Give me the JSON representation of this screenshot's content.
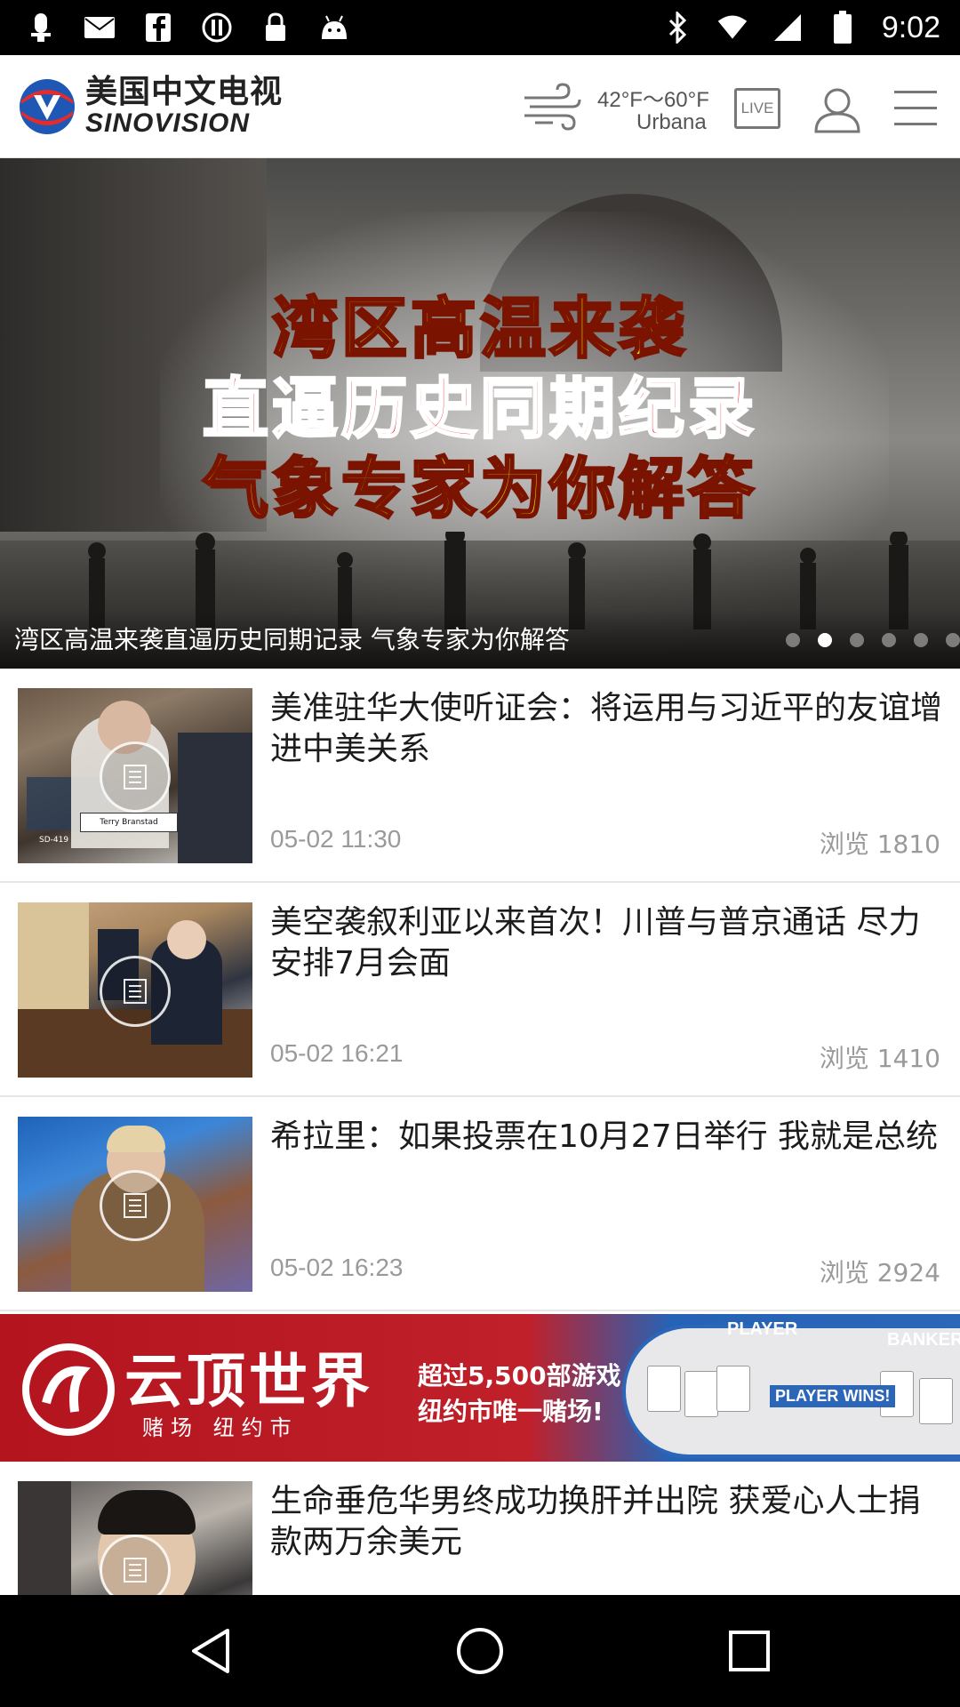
{
  "status_bar": {
    "time": "9:02",
    "left_icons": [
      "notification-icon",
      "mail-icon",
      "facebook-icon",
      "circle-alert-icon",
      "lock-icon",
      "android-icon"
    ],
    "right_icons": [
      "bluetooth-icon",
      "wifi-icon",
      "signal-icon",
      "battery-icon"
    ]
  },
  "header": {
    "logo_cn": "美国中文电视",
    "logo_en": "SINOVISION",
    "weather": {
      "temp": "42°F～60°F",
      "city": "Urbana",
      "icon": "wind-icon"
    },
    "live_label": "LIVE",
    "user_icon": "user-icon",
    "menu_icon": "hamburger-menu-icon"
  },
  "banner": {
    "overlay_lines": [
      "湾区高温来袭",
      "直逼历史同期纪录",
      "气象专家为你解答"
    ],
    "caption": "湾区高温来袭直逼历史同期记录 气象专家为你解答",
    "dot_count": 6,
    "active_dot": 1
  },
  "feed": {
    "items": [
      {
        "title": "美准驻华大使听证会：将运用与习近平的友谊增进中美关系",
        "time": "05-02 11:30",
        "views": "浏览 1810"
      },
      {
        "title": "美空袭叙利亚以来首次！川普与普京通话 尽力安排7月会面",
        "time": "05-02 16:21",
        "views": "浏览 1410"
      },
      {
        "title": "希拉里：如果投票在10月27日举行 我就是总统",
        "time": "05-02 16:23",
        "views": "浏览 2924"
      },
      {
        "title": "生命垂危华男终成功换肝并出院 获爱心人士捐款两万余美元",
        "time": "",
        "views": ""
      }
    ],
    "thumb_captions": [
      "Terry Branstad",
      "SD-419"
    ],
    "ad": {
      "brand": "云顶世界",
      "sub": "赌场 纽约市",
      "line1": "超过5,500部游戏,",
      "line2": "纽约市唯一赌场!",
      "player": "PLAYER",
      "banker": "BANKER",
      "player_wins": "PLAYER WINS!"
    }
  },
  "nav_bar": {
    "back_icon": "back-triangle-icon",
    "home_icon": "home-circle-icon",
    "recent_icon": "recent-apps-square-icon"
  },
  "colors": {
    "header_bg": "#ffffff",
    "meta_text": "#9a9a9a",
    "title_text": "#1c1c1c",
    "overlay_yellow": "#e8e600",
    "overlay_red": "#e00a0a"
  }
}
